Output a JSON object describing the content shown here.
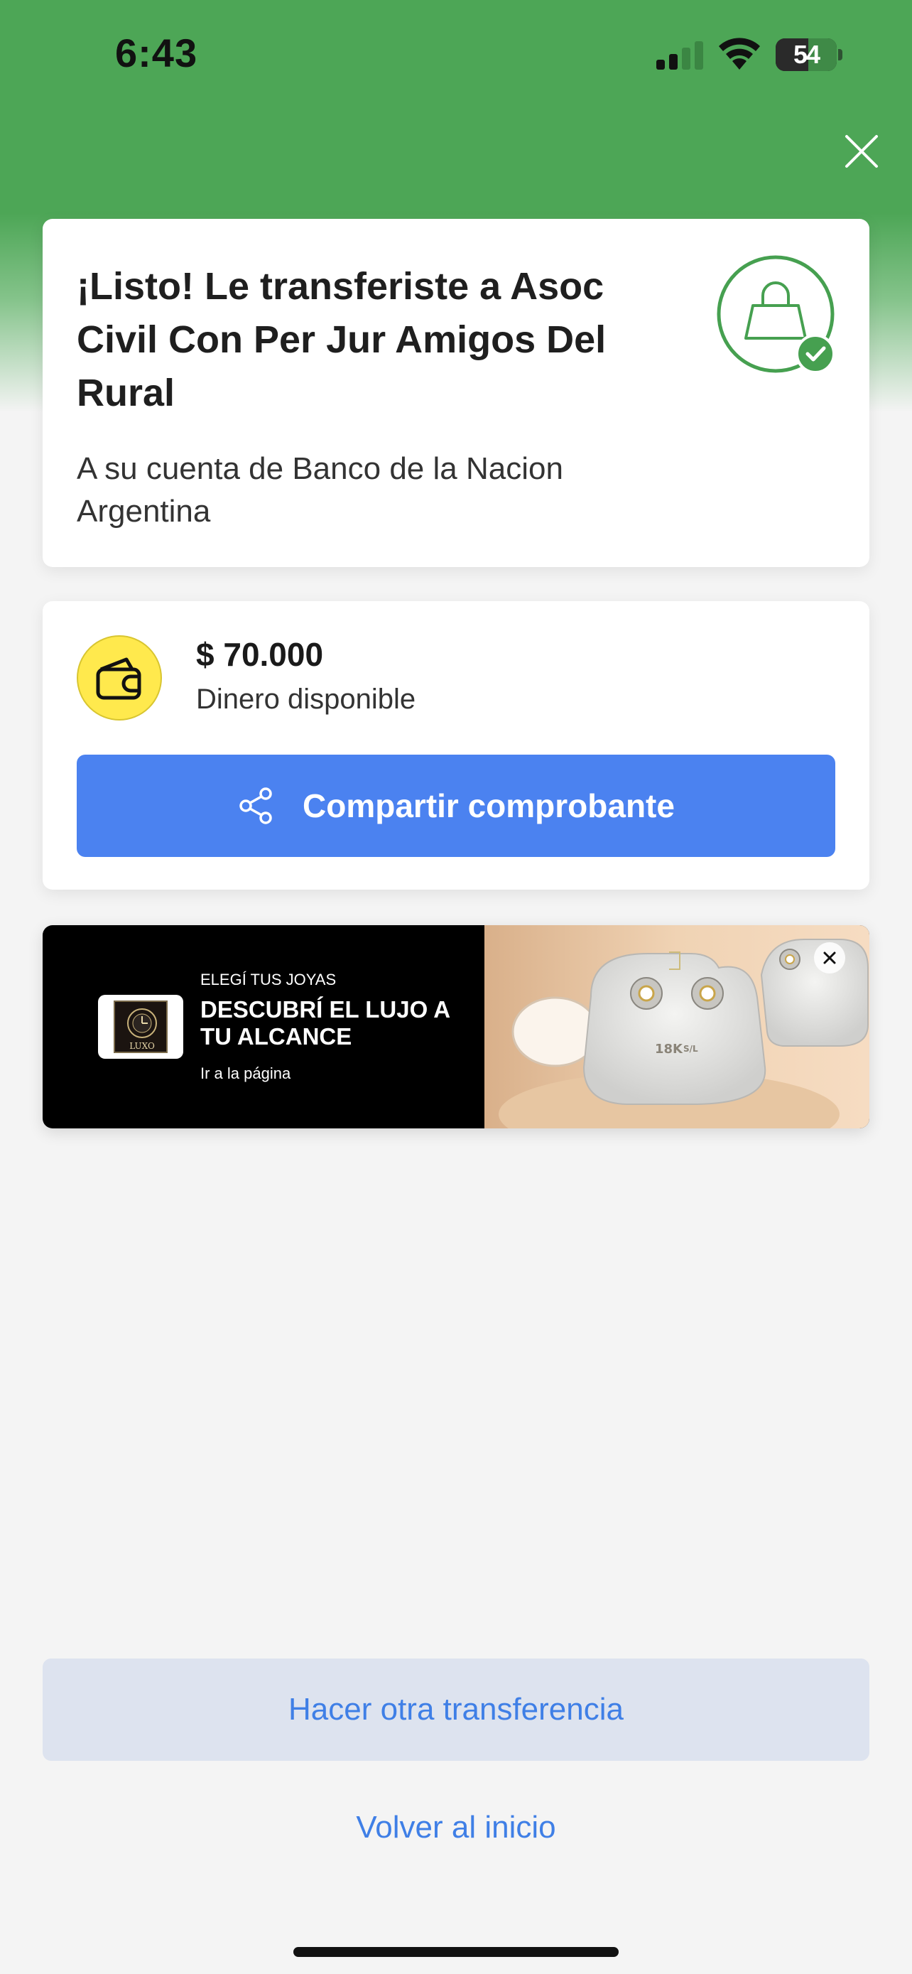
{
  "status_bar": {
    "time": "6:43",
    "battery_level": "54"
  },
  "success_card": {
    "title": "¡Listo! Le transferiste a Asoc Civil Con Per Jur Amigos Del Rural",
    "subtitle": "A su cuenta de Banco de la Nacion Argentina",
    "icon": "shopping-bag-check-icon"
  },
  "amount_card": {
    "amount": "$ 70.000",
    "label": "Dinero disponible",
    "icon": "wallet-icon",
    "share_button": "Compartir comprobante"
  },
  "ad": {
    "overline": "ELEGÍ TUS JOYAS",
    "headline": "DESCUBRÍ EL LUJO A TU ALCANCE",
    "link": "Ir a la página",
    "logo_text": "LUXO",
    "image_text_1": "18K",
    "image_text_2": "S/L"
  },
  "actions": {
    "other_transfer": "Hacer otra transferencia",
    "back_home": "Volver al inicio"
  },
  "colors": {
    "header_green": "#4da656",
    "primary_blue": "#4b82f0",
    "link_blue": "#3f7fe6",
    "wallet_yellow": "#ffe94d",
    "success_green": "#46a050"
  }
}
